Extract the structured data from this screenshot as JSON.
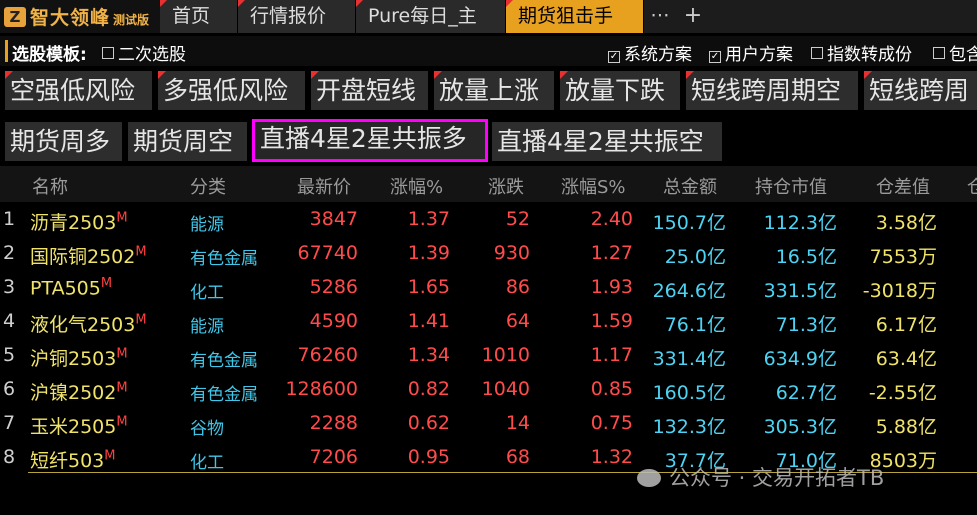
{
  "app": {
    "logo_glyph": "Z",
    "name": "智大领峰",
    "edition": "测试版"
  },
  "tabs": [
    {
      "label": "首页",
      "active": false
    },
    {
      "label": "行情报价",
      "active": false
    },
    {
      "label": "Pure每日_主",
      "active": false
    },
    {
      "label": "期货狙击手",
      "active": true
    }
  ],
  "tab_more": "⋯",
  "tab_add": "+",
  "selector": {
    "title": "选股模板:",
    "options": [
      {
        "label": "二次选股",
        "checked": false
      },
      {
        "label": "系统方案",
        "checked": true
      },
      {
        "label": "用户方案",
        "checked": true
      },
      {
        "label": "指数转成份",
        "checked": false
      },
      {
        "label": "包含",
        "checked": false
      }
    ]
  },
  "strategies_row1": [
    "空强低风险",
    "多强低风险",
    "开盘短线",
    "放量上涨",
    "放量下跌",
    "短线跨周期空",
    "短线跨周"
  ],
  "strategies_row2": [
    "期货周多",
    "期货周空",
    "直播4星2星共振多",
    "直播4星2星共振空"
  ],
  "selected_strategy": "直播4星2星共振多",
  "table": {
    "headers": [
      "名称",
      "分类",
      "最新价",
      "涨幅%",
      "涨跌",
      "涨幅S%",
      "总金额",
      "持仓市值",
      "仓差值",
      "仓"
    ],
    "rows": [
      {
        "idx": "1",
        "name": "沥青2503",
        "mark": "M",
        "cat": "能源",
        "price": "3847",
        "chg_pct": "1.37",
        "chg": "52",
        "chg_s": "2.40",
        "amount": "150.7亿",
        "oi_value": "112.3亿",
        "oi_diff": "3.58亿"
      },
      {
        "idx": "2",
        "name": "国际铜2502",
        "mark": "M",
        "cat": "有色金属",
        "price": "67740",
        "chg_pct": "1.39",
        "chg": "930",
        "chg_s": "1.27",
        "amount": "25.0亿",
        "oi_value": "16.5亿",
        "oi_diff": "7553万"
      },
      {
        "idx": "3",
        "name": "PTA505",
        "mark": "M",
        "cat": "化工",
        "price": "5286",
        "chg_pct": "1.65",
        "chg": "86",
        "chg_s": "1.93",
        "amount": "264.6亿",
        "oi_value": "331.5亿",
        "oi_diff": "-3018万"
      },
      {
        "idx": "4",
        "name": "液化气2503",
        "mark": "M",
        "cat": "能源",
        "price": "4590",
        "chg_pct": "1.41",
        "chg": "64",
        "chg_s": "1.59",
        "amount": "76.1亿",
        "oi_value": "71.3亿",
        "oi_diff": "6.17亿"
      },
      {
        "idx": "5",
        "name": "沪铜2503",
        "mark": "M",
        "cat": "有色金属",
        "price": "76260",
        "chg_pct": "1.34",
        "chg": "1010",
        "chg_s": "1.17",
        "amount": "331.4亿",
        "oi_value": "634.9亿",
        "oi_diff": "63.4亿"
      },
      {
        "idx": "6",
        "name": "沪镍2502",
        "mark": "M",
        "cat": "有色金属",
        "price": "128600",
        "chg_pct": "0.82",
        "chg": "1040",
        "chg_s": "0.85",
        "amount": "160.5亿",
        "oi_value": "62.7亿",
        "oi_diff": "-2.55亿"
      },
      {
        "idx": "7",
        "name": "玉米2505",
        "mark": "M",
        "cat": "谷物",
        "price": "2288",
        "chg_pct": "0.62",
        "chg": "14",
        "chg_s": "0.75",
        "amount": "132.3亿",
        "oi_value": "305.3亿",
        "oi_diff": "5.88亿"
      },
      {
        "idx": "8",
        "name": "短纤503",
        "mark": "M",
        "cat": "化工",
        "price": "7206",
        "chg_pct": "0.95",
        "chg": "68",
        "chg_s": "1.32",
        "amount": "37.7亿",
        "oi_value": "71.0亿",
        "oi_diff": "8503万"
      }
    ]
  },
  "watermark": "公众号 · 交易开拓者TB",
  "colors": {
    "accent": "#e8a01f",
    "selected_border": "#ff00ff",
    "up": "#ff4b4b",
    "category": "#3fc6e8",
    "name": "#f0e36a"
  }
}
